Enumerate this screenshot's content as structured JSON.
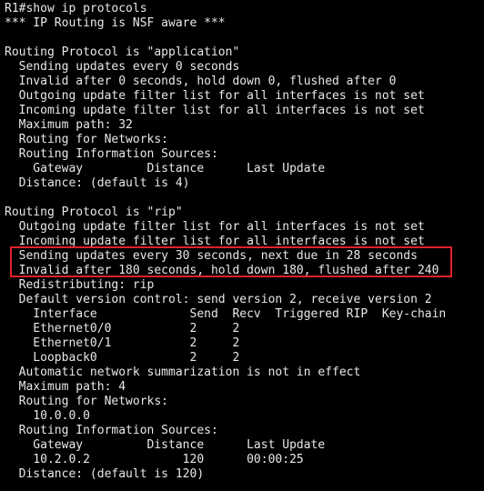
{
  "terminal": {
    "lines": [
      "R1#show ip protocols",
      "*** IP Routing is NSF aware ***",
      "",
      "Routing Protocol is \"application\"",
      "  Sending updates every 0 seconds",
      "  Invalid after 0 seconds, hold down 0, flushed after 0",
      "  Outgoing update filter list for all interfaces is not set",
      "  Incoming update filter list for all interfaces is not set",
      "  Maximum path: 32",
      "  Routing for Networks:",
      "  Routing Information Sources:",
      "    Gateway         Distance      Last Update",
      "  Distance: (default is 4)",
      "",
      "Routing Protocol is \"rip\"",
      "  Outgoing update filter list for all interfaces is not set",
      "  Incoming update filter list for all interfaces is not set",
      "  Sending updates every 30 seconds, next due in 28 seconds",
      "  Invalid after 180 seconds, hold down 180, flushed after 240",
      "  Redistributing: rip",
      "  Default version control: send version 2, receive version 2",
      "    Interface             Send  Recv  Triggered RIP  Key-chain",
      "    Ethernet0/0           2     2",
      "    Ethernet0/1           2     2",
      "    Loopback0             2     2",
      "  Automatic network summarization is not in effect",
      "  Maximum path: 4",
      "  Routing for Networks:",
      "    10.0.0.0",
      "  Routing Information Sources:",
      "    Gateway         Distance      Last Update",
      "    10.2.0.2             120      00:00:25",
      "  Distance: (default is 120)"
    ]
  },
  "colors": {
    "background": "#000000",
    "text": "#e8e8e8",
    "highlight_border": "#e0212b"
  }
}
